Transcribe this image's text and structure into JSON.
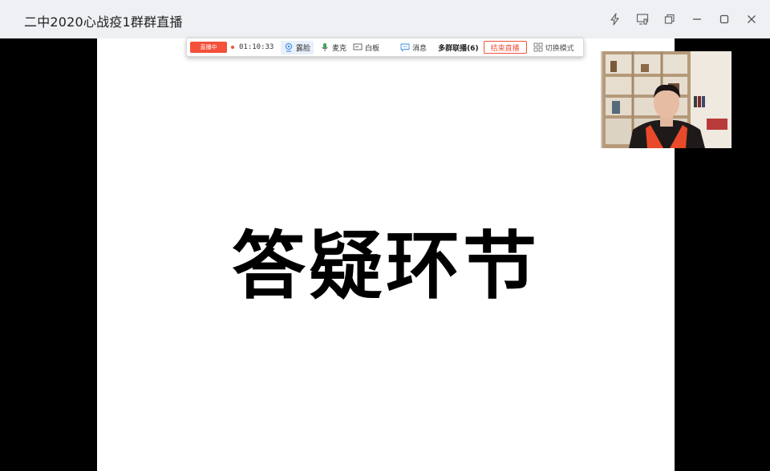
{
  "window": {
    "title": "二中2020心战疫1群群直播"
  },
  "toolbar": {
    "live_badge": "直播中",
    "timer": "01:10:33",
    "face_label": "露脸",
    "mic_label": "麦克",
    "whiteboard_label": "白板",
    "message_label": "消息",
    "multi_group_label": "多群联播(6)",
    "end_live_label": "结束直播",
    "switch_mode_label": "切换模式"
  },
  "slide": {
    "title": "答疑环节"
  },
  "colors": {
    "accent_red": "#f4503a",
    "titlebar_bg": "#eef0f4",
    "active_blue": "#3a8ee6"
  }
}
